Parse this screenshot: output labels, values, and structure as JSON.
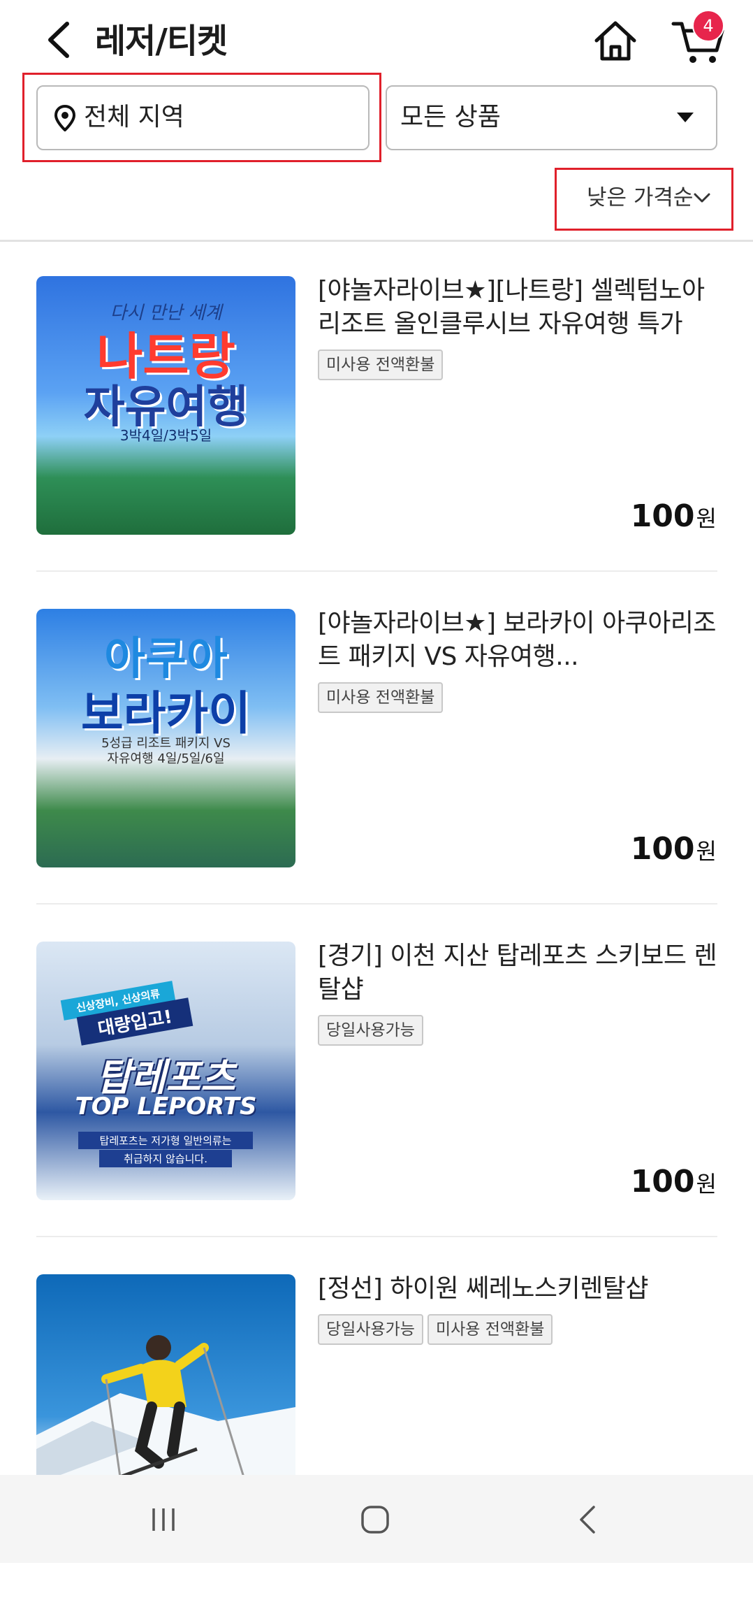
{
  "header": {
    "title": "레저/티켓",
    "cart_count": "4"
  },
  "filters": {
    "region": "전체 지역",
    "category": "모든 상품",
    "sort": "낮은 가격순"
  },
  "products": [
    {
      "title": "[야놀자라이브★][나트랑] 셀렉텀노아리조트 올인클루시브 자유여행 특가",
      "tags": [
        "미사용 전액환불"
      ],
      "price": "100",
      "currency": "원",
      "image_text": {
        "small": "다시 만난 세계",
        "line1": "나트랑",
        "line2": "자유여행",
        "sub": "3박4일/3박5일"
      }
    },
    {
      "title": "[야놀자라이브★] 보라카이 아쿠아리조트 패키지 VS 자유여행...",
      "tags": [
        "미사용 전액환불"
      ],
      "price": "100",
      "currency": "원",
      "image_text": {
        "line1": "아쿠아",
        "line2": "보라카이",
        "sub1": "5성급 리조트 패키지 VS",
        "sub2": "자유여행 4일/5일/6일"
      }
    },
    {
      "title": "[경기] 이천 지산 탑레포츠 스키보드 렌탈샵",
      "tags": [
        "당일사용가능"
      ],
      "price": "100",
      "currency": "원",
      "image_text": {
        "badge1": "신상장비, 신상의류",
        "badge2": "대량입고!",
        "line1": "탑레포츠",
        "line2": "TOP LEPORTS",
        "sub1": "탑레포츠는 저가형 일반의류는",
        "sub2": "취급하지 않습니다."
      }
    },
    {
      "title": "[정선] 하이원 쎄레노스키렌탈샵",
      "tags": [
        "당일사용가능",
        "미사용 전액환불"
      ],
      "price": "",
      "currency": ""
    }
  ],
  "colors": {
    "accent_red": "#e0202b",
    "badge": "#e7254c"
  }
}
